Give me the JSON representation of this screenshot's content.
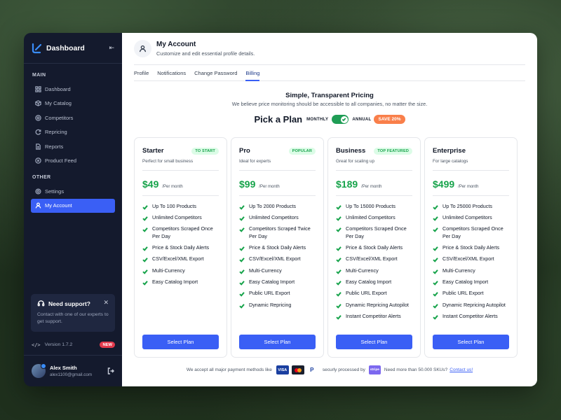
{
  "sidebar": {
    "title": "Dashboard",
    "main_label": "MAIN",
    "main_items": [
      {
        "label": "Dashboard",
        "icon": "grid-icon"
      },
      {
        "label": "My Catalog",
        "icon": "box-icon"
      },
      {
        "label": "Competitors",
        "icon": "target-icon"
      },
      {
        "label": "Repricing",
        "icon": "refresh-icon"
      },
      {
        "label": "Reports",
        "icon": "file-icon"
      },
      {
        "label": "Product Feed",
        "icon": "rss-icon"
      }
    ],
    "other_label": "OTHER",
    "other_items": [
      {
        "label": "Settings",
        "icon": "gear-icon"
      },
      {
        "label": "My Account",
        "icon": "user-icon",
        "active": true
      }
    ],
    "support": {
      "title": "Need support?",
      "text": "Contact with one of our experts to get support."
    },
    "version": "Version 1.7.2",
    "version_badge": "NEW",
    "user": {
      "name": "Alex Smith",
      "email": "alex1100@gmail.com"
    }
  },
  "header": {
    "title": "My Account",
    "subtitle": "Customize and edit essential profile details."
  },
  "tabs": [
    {
      "label": "Profile"
    },
    {
      "label": "Notifications"
    },
    {
      "label": "Change Password"
    },
    {
      "label": "Billing",
      "active": true
    }
  ],
  "pricing": {
    "title": "Simple, Transparent Pricing",
    "subtitle": "We believe price monitoring should be accessible to all companies, no matter the size.",
    "pick_title": "Pick a Plan",
    "monthly_label": "MONTHLY",
    "annual_label": "ANNUAL",
    "save_badge": "SAVE 20%",
    "billing_annual": true
  },
  "plans": [
    {
      "name": "Starter",
      "badge": "TO START",
      "desc": "Perfect for small business",
      "price": "$49",
      "per": "/Per month",
      "features": [
        "Up To 100 Products",
        "Unlimited Competitors",
        "Competitors Scraped Once Per Day",
        "Price & Stock Daily Alerts",
        "CSV/Excel/XML Export",
        "Multi-Currency",
        "Easy Catalog Import"
      ],
      "button": "Select Plan"
    },
    {
      "name": "Pro",
      "badge": "POPULAR",
      "desc": "Ideal for experts",
      "price": "$99",
      "per": "/Per month",
      "features": [
        "Up To 2000 Products",
        "Unlimited Competitors",
        "Competitors Scraped Twice Per Day",
        "Price & Stock Daily Alerts",
        "CSV/Excel/XML Export",
        "Multi-Currency",
        "Easy Catalog Import",
        "Public URL Export",
        "Dynamic Repricing"
      ],
      "button": "Select Plan"
    },
    {
      "name": "Business",
      "badge": "TOP FEATURED",
      "desc": "Great for scaling up",
      "price": "$189",
      "per": "/Per month",
      "features": [
        "Up To 15000 Products",
        "Unlimited Competitors",
        "Competitors Scraped Once Per Day",
        "Price & Stock Daily Alerts",
        "CSV/Excel/XML Export",
        "Multi-Currency",
        "Easy Catalog Import",
        "Public URL Export",
        "Dynamic Repricing Autopilot",
        "Instant Competitor Alerts"
      ],
      "button": "Select Plan"
    },
    {
      "name": "Enterprise",
      "badge": "",
      "desc": "For large catalogs",
      "price": "$499",
      "per": "/Per month",
      "features": [
        "Up To 25000 Products",
        "Unlimited Competitors",
        "Competitors Scraped Once Per Day",
        "Price & Stock Daily Alerts",
        "CSV/Excel/XML Export",
        "Multi-Currency",
        "Easy Catalog Import",
        "Public URL Export",
        "Dynamic Repricing Autopilot",
        "Instant Competitor Alerts"
      ],
      "button": "Select Plan"
    }
  ],
  "footer": {
    "accept_text": "We accept all major payment methods like",
    "visa": "VISA",
    "paypal": "P",
    "secure_text": "securly processed by",
    "stripe": "stripe",
    "sku_text": "Need more than 50.000 SKUs?",
    "contact_link": "Contact us!"
  },
  "colors": {
    "accent": "#3a5ff5",
    "sidebar_bg": "#141a2d",
    "price_green": "#16a34a",
    "save_orange": "#f97f4a",
    "new_red": "#e23a4d"
  }
}
